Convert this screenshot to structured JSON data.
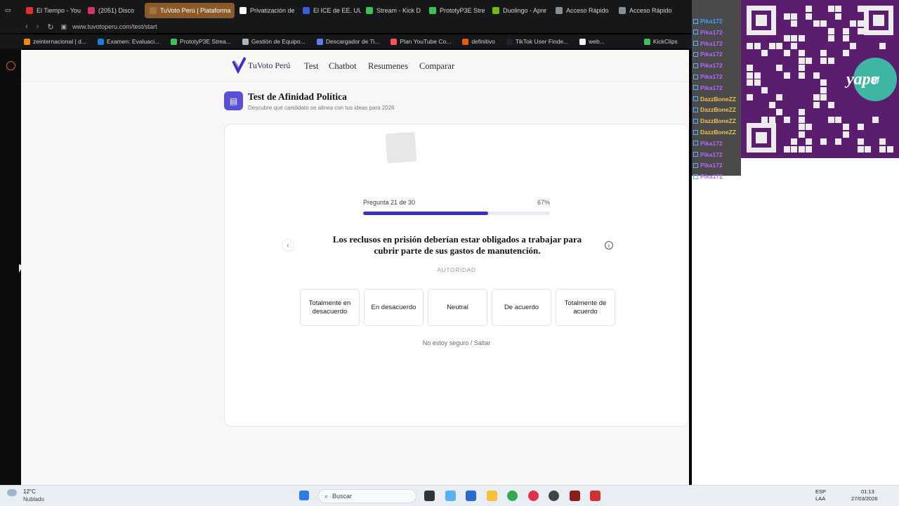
{
  "browser": {
    "tabs": [
      {
        "label": "El Tiempo - You",
        "color": "#e03131",
        "active": false
      },
      {
        "label": "(2051) Disco",
        "color": "#d6336c",
        "active": false
      },
      {
        "label": "TuVoto Perú | Plataforma",
        "color": "#a5743a",
        "active": true
      },
      {
        "label": "Privatización de",
        "color": "#ffffff",
        "active": false
      },
      {
        "label": "El ICE de EE. UU.",
        "color": "#3b5bdb",
        "active": false
      },
      {
        "label": "Stream - Kick D",
        "color": "#40c057",
        "active": false
      },
      {
        "label": "PrototyP3E Stre",
        "color": "#40c057",
        "active": false
      },
      {
        "label": "Duolingo - Apre",
        "color": "#74b816",
        "active": false
      },
      {
        "label": "Acceso Rápido",
        "color": "#868e96",
        "active": false
      },
      {
        "label": "Acceso Rápido",
        "color": "#868e96",
        "active": false
      }
    ],
    "url": "www.tuvotoperu.com/test/start",
    "bookmarks": [
      {
        "label": "zeinternacional | d...",
        "color": "#f08c00"
      },
      {
        "label": "Examen: Evaluaci...",
        "color": "#1c7ed6"
      },
      {
        "label": "PrototyP3E Strea...",
        "color": "#40c057"
      },
      {
        "label": "Gestión de Equipo...",
        "color": "#adb5bd"
      },
      {
        "label": "Descargador de Ti...",
        "color": "#5c7cfa"
      },
      {
        "label": "Plan YouTube Co...",
        "color": "#fa5252"
      },
      {
        "label": "definitivo",
        "color": "#e8590c"
      },
      {
        "label": "TikTok User Finde...",
        "color": "#212529"
      },
      {
        "label": "web...",
        "color": "#f1f3f5"
      },
      {
        "label": "KickClips",
        "color": "#40c057"
      }
    ]
  },
  "site": {
    "logo": "TuVoto Perú",
    "nav": [
      "Test",
      "Chatbot",
      "Resumenes",
      "Comparar"
    ],
    "title": "Test de Afinidad Política",
    "subtitle": "Descubre qué candidato se alinea con tus ideas para 2026",
    "progress_label": "Pregunta 21 de 30",
    "progress_percent_label": "67%",
    "progress_fraction": 0.67,
    "question": "Los reclusos en prisión deberían estar obligados a trabajar para cubrir parte de sus gastos de manutención.",
    "category": "AUTORIDAD",
    "options": [
      "Totalmente en desacuerdo",
      "En desacuerdo",
      "Neutral",
      "De acuerdo",
      "Totalmente de acuerdo"
    ],
    "skip": "No estoy seguro / Saltar"
  },
  "overlay": {
    "chat": [
      {
        "user": "Pika172",
        "color": "#3ca0ff"
      },
      {
        "user": "Pika172",
        "color": "#b565ff"
      },
      {
        "user": "Pika172",
        "color": "#b565ff"
      },
      {
        "user": "Pika172",
        "color": "#b565ff"
      },
      {
        "user": "Pika172",
        "color": "#b565ff"
      },
      {
        "user": "Pika172",
        "color": "#b565ff"
      },
      {
        "user": "Pika172",
        "color": "#b565ff"
      },
      {
        "user": "DazzBoneZZ",
        "color": "#f0c14b"
      },
      {
        "user": "DazzBoneZZ",
        "color": "#f0c14b"
      },
      {
        "user": "DazzBoneZZ",
        "color": "#f0c14b"
      },
      {
        "user": "DazzBoneZZ",
        "color": "#f0c14b"
      },
      {
        "user": "Pika172",
        "color": "#b565ff"
      },
      {
        "user": "Pika172",
        "color": "#b565ff"
      },
      {
        "user": "Pika172",
        "color": "#b565ff"
      },
      {
        "user": "Pika172",
        "color": "#b565ff"
      }
    ],
    "qr_badge": "S/",
    "qr_brand": "yape"
  },
  "taskbar": {
    "weather_temp": "12°C",
    "weather_desc": "Nublado",
    "search_placeholder": "Buscar",
    "lang": "ESP",
    "lang2": "LAA",
    "time": "01:13",
    "date": "27/03/2026"
  }
}
